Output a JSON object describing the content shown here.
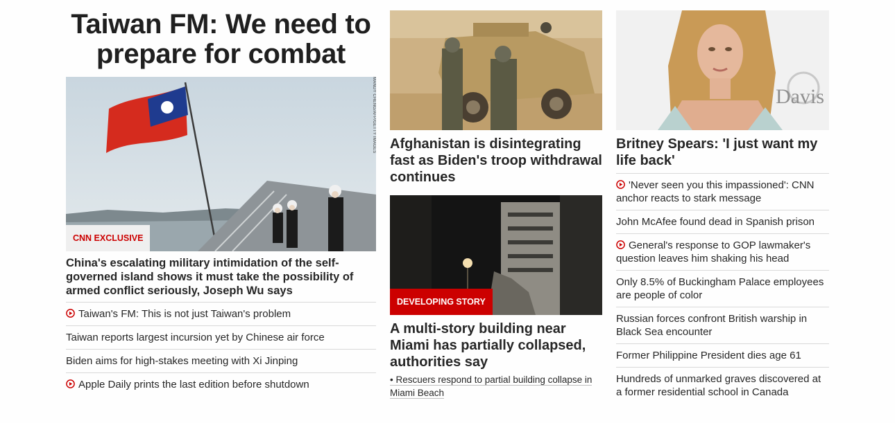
{
  "left": {
    "title": "Taiwan FM: We need to prepare for combat",
    "badge": "CNN EXCLUSIVE",
    "photo_credit": "MANDY CHENG/AFP/GETTY IMAGES",
    "headline": "China's escalating military intimidation of the self-governed island shows it must take the possibility of armed conflict seriously, Joseph Wu says",
    "links": [
      {
        "text": "Taiwan's FM: This is not just Taiwan's problem",
        "icon": "play-icon"
      },
      {
        "text": "Taiwan reports largest incursion yet by Chinese air force",
        "icon": ""
      },
      {
        "text": "Biden aims for high-stakes meeting with Xi Jinping",
        "icon": ""
      },
      {
        "text": "Apple Daily prints the last edition before shutdown",
        "icon": "play-icon"
      }
    ]
  },
  "middle": {
    "story1": {
      "headline": "Afghanistan is disintegrating fast as Biden's troop withdrawal continues"
    },
    "story2": {
      "badge": "DEVELOPING STORY",
      "headline": "A multi-story building near Miami has partially collapsed, authorities say",
      "sublink": "• Rescuers respond to partial building collapse in Miami Beach"
    }
  },
  "right": {
    "photo_text": "Davis",
    "headline": "Britney Spears: 'I just want my life back'",
    "links": [
      {
        "text": "'Never seen you this impassioned': CNN anchor reacts to stark message",
        "icon": "play-icon"
      },
      {
        "text": "John McAfee found dead in Spanish prison",
        "icon": ""
      },
      {
        "text": "General's response to GOP lawmaker's question leaves him shaking his head",
        "icon": "play-icon"
      },
      {
        "text": "Only 8.5% of Buckingham Palace employees are people of color",
        "icon": ""
      },
      {
        "text": "Russian forces confront British warship in Black Sea encounter",
        "icon": ""
      },
      {
        "text": "Former Philippine President dies age 61",
        "icon": ""
      },
      {
        "text": "Hundreds of unmarked graves discovered at a former residential school in Canada",
        "icon": ""
      }
    ]
  },
  "colors": {
    "accent_red": "#cc0000",
    "text": "#262626",
    "divider": "#d9d9d9"
  }
}
